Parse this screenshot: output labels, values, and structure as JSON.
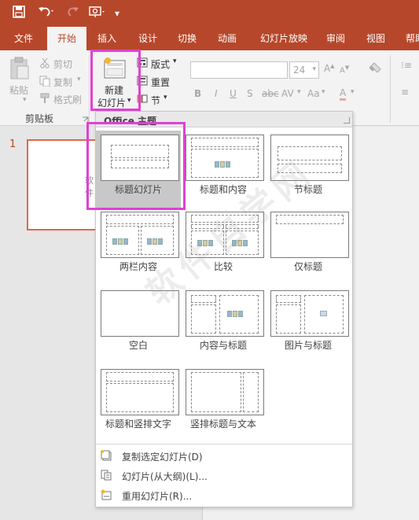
{
  "quick_access": {
    "save_icon": "save-icon",
    "undo_icon": "undo-icon",
    "redo_icon": "redo-icon",
    "present_icon": "start-slideshow-icon",
    "customize": "▾"
  },
  "tabs": [
    "文件",
    "开始",
    "插入",
    "设计",
    "切换",
    "动画",
    "幻灯片放映",
    "审阅",
    "视图",
    "帮助"
  ],
  "ribbon": {
    "clipboard": {
      "paste": "粘贴",
      "cut": "剪切",
      "copy": "复制",
      "format_painter": "格式刷",
      "group_label": "剪贴板"
    },
    "slides": {
      "new_slide_line1": "新建",
      "new_slide_line2": "幻灯片",
      "layout": "版式",
      "reset": "重置",
      "section": "节"
    },
    "font": {
      "font_size": "24",
      "bold": "B",
      "italic": "I",
      "underline": "U",
      "shadow": "S",
      "strike": "abc",
      "spacing": "AV",
      "case": "Aa",
      "color": "A"
    }
  },
  "slide_pane": {
    "slide_number": "1",
    "thumb_text": "软件"
  },
  "dropdown": {
    "header": "Office 主题",
    "layouts": [
      {
        "label": "标题幻灯片"
      },
      {
        "label": "标题和内容"
      },
      {
        "label": "节标题"
      },
      {
        "label": "两栏内容"
      },
      {
        "label": "比较"
      },
      {
        "label": "仅标题"
      },
      {
        "label": "空白"
      },
      {
        "label": "内容与标题"
      },
      {
        "label": "图片与标题"
      },
      {
        "label": "标题和竖排文字"
      },
      {
        "label": "竖排标题与文本"
      }
    ],
    "menu": [
      {
        "label": "复制选定幻灯片(D)"
      },
      {
        "label": "幻灯片(从大纲)(L)..."
      },
      {
        "label": "重用幻灯片(R)..."
      }
    ]
  },
  "watermark": "软件自学网",
  "colors": {
    "accent": "#b7472a",
    "highlight": "#e040d6",
    "slide_border": "#e1674a"
  }
}
